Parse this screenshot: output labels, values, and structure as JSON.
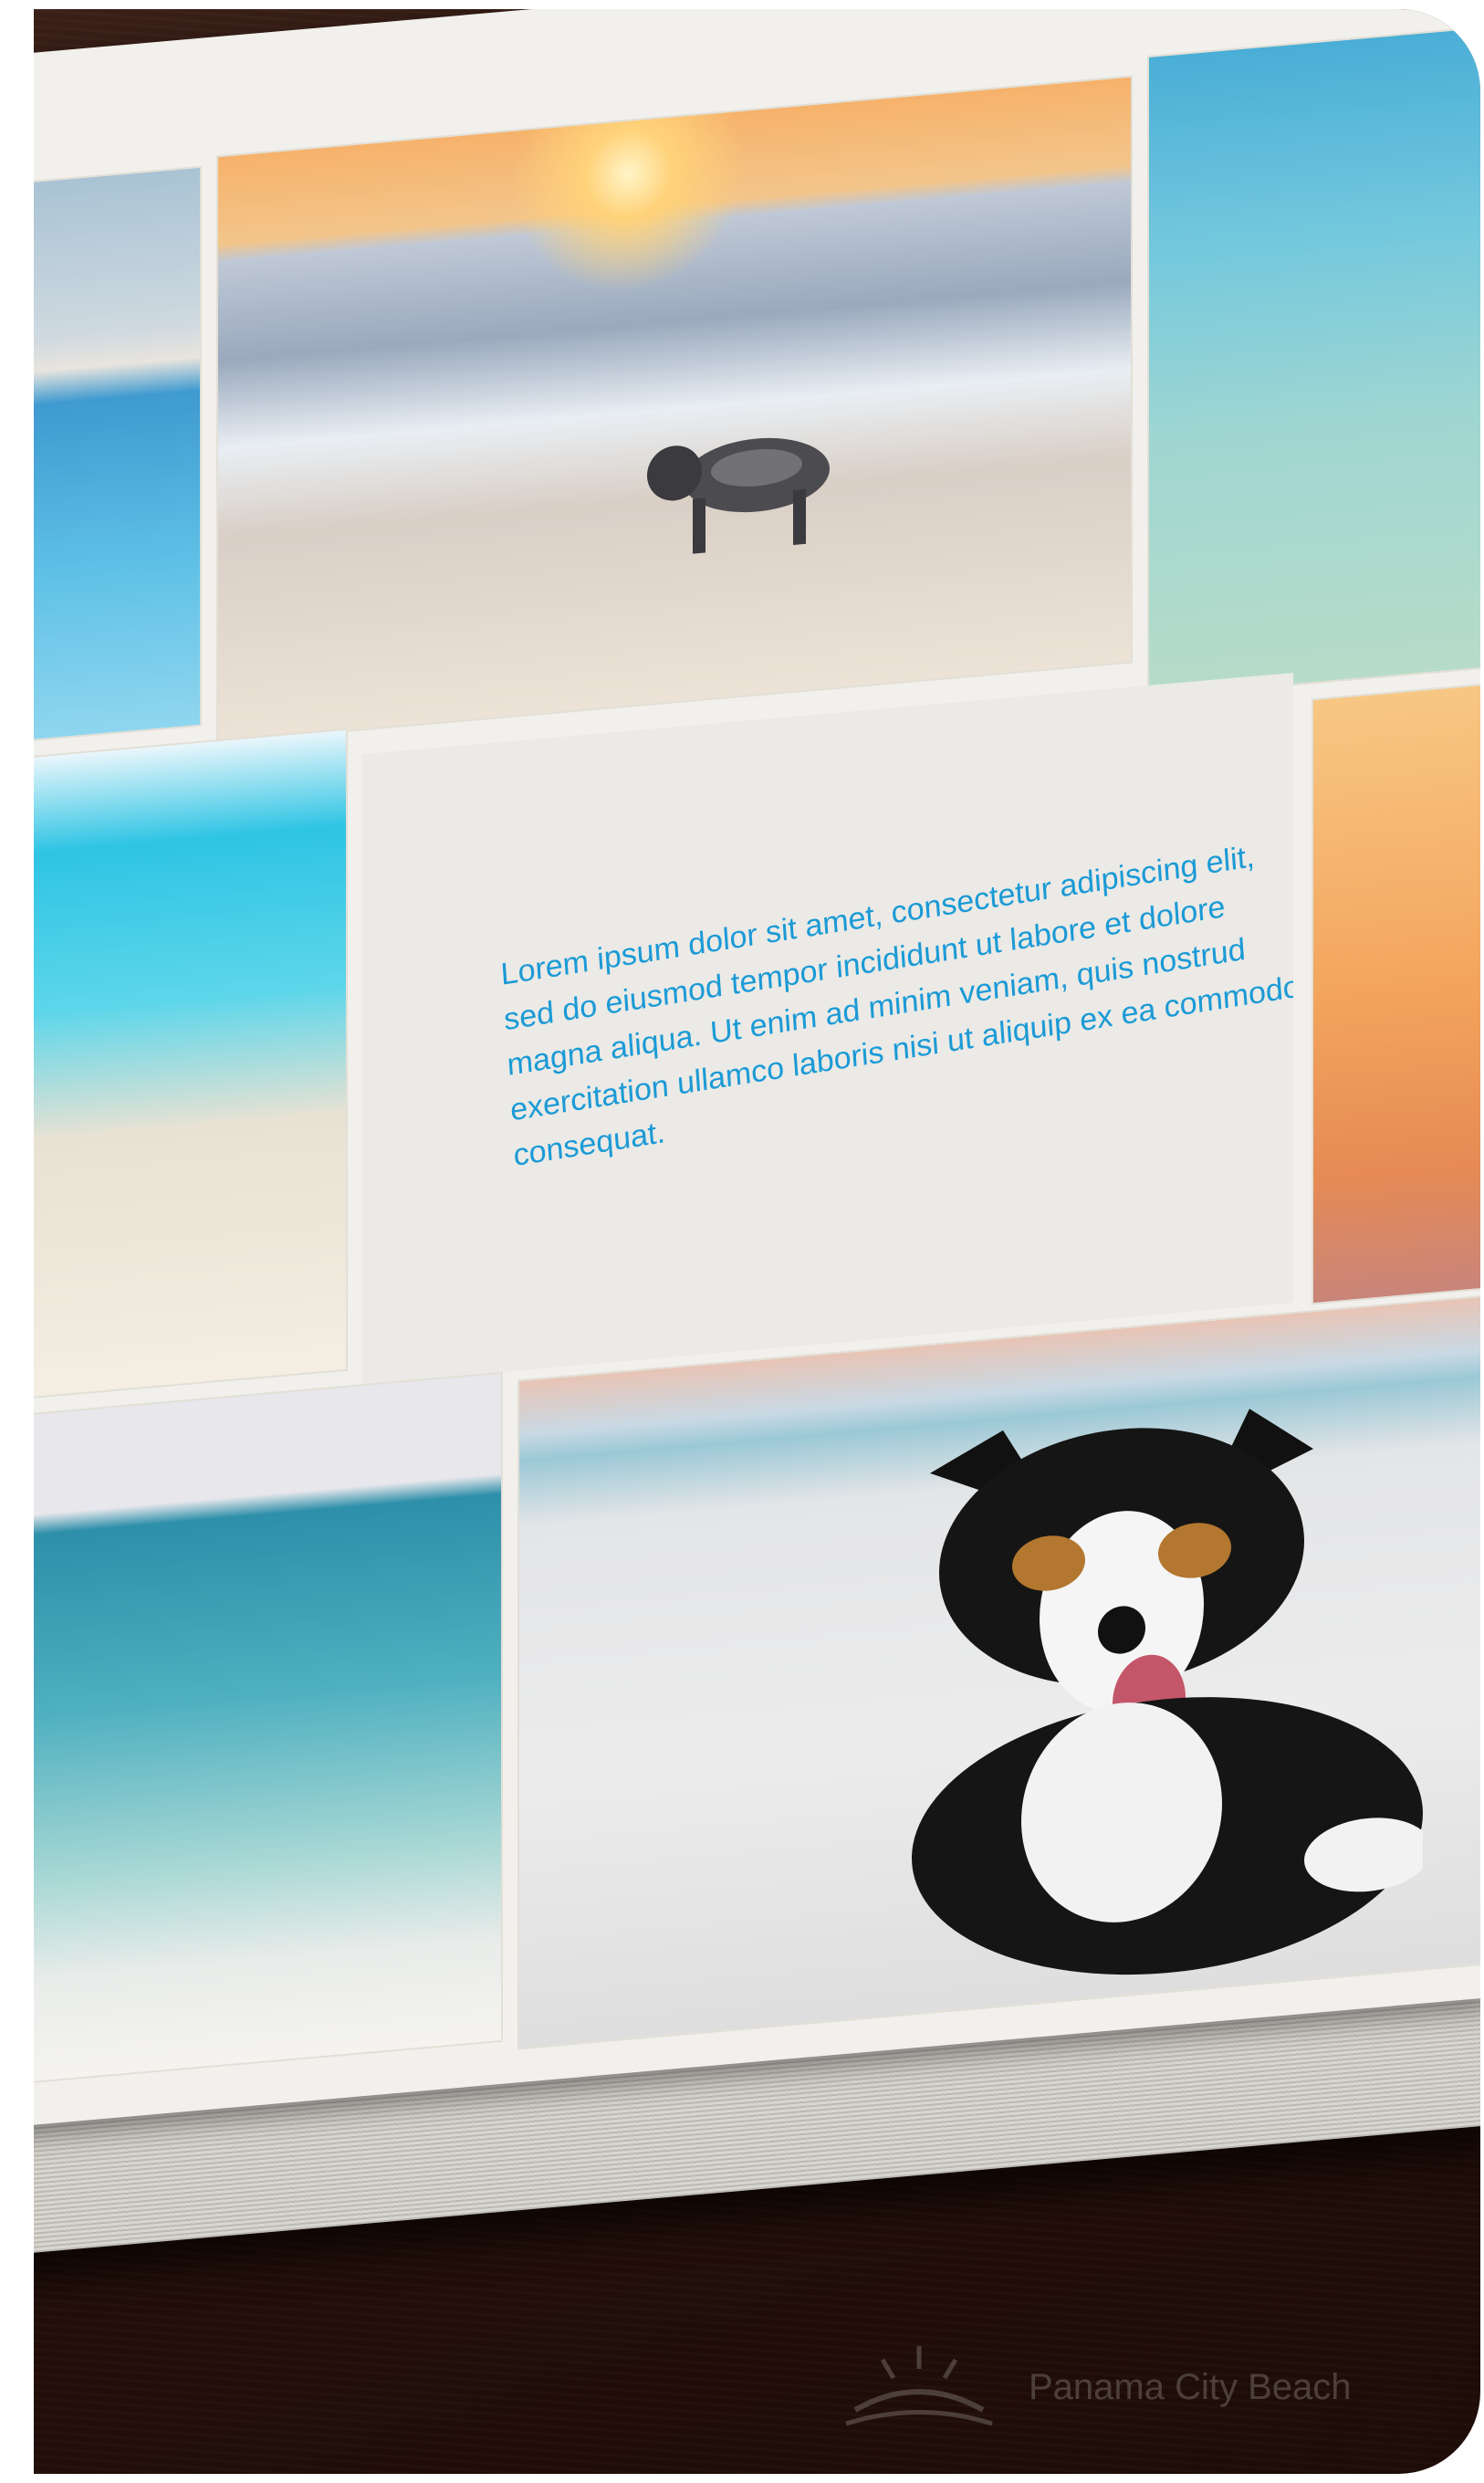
{
  "photo_book": {
    "caption": "Lorem ipsum dolor sit amet, consectetur  adipiscing elit, sed do eiusmod tempor  incididunt ut labore et dolore magna aliqua. Ut enim ad minim veniam, quis nostrud exercitation ullamco laboris nisi ut aliquip ex ea commodo consequat.",
    "caption_color": "#1b9ad6",
    "photos": [
      "pool",
      "dog-on-beach-at-sunset",
      "person-wading-in-water",
      "shoreline",
      "sunset",
      "sea",
      "dog-lying-in-sand",
      "blue-water"
    ]
  },
  "watermark": {
    "text": "Panama City Beach",
    "icon": "sunset-logo-icon"
  }
}
